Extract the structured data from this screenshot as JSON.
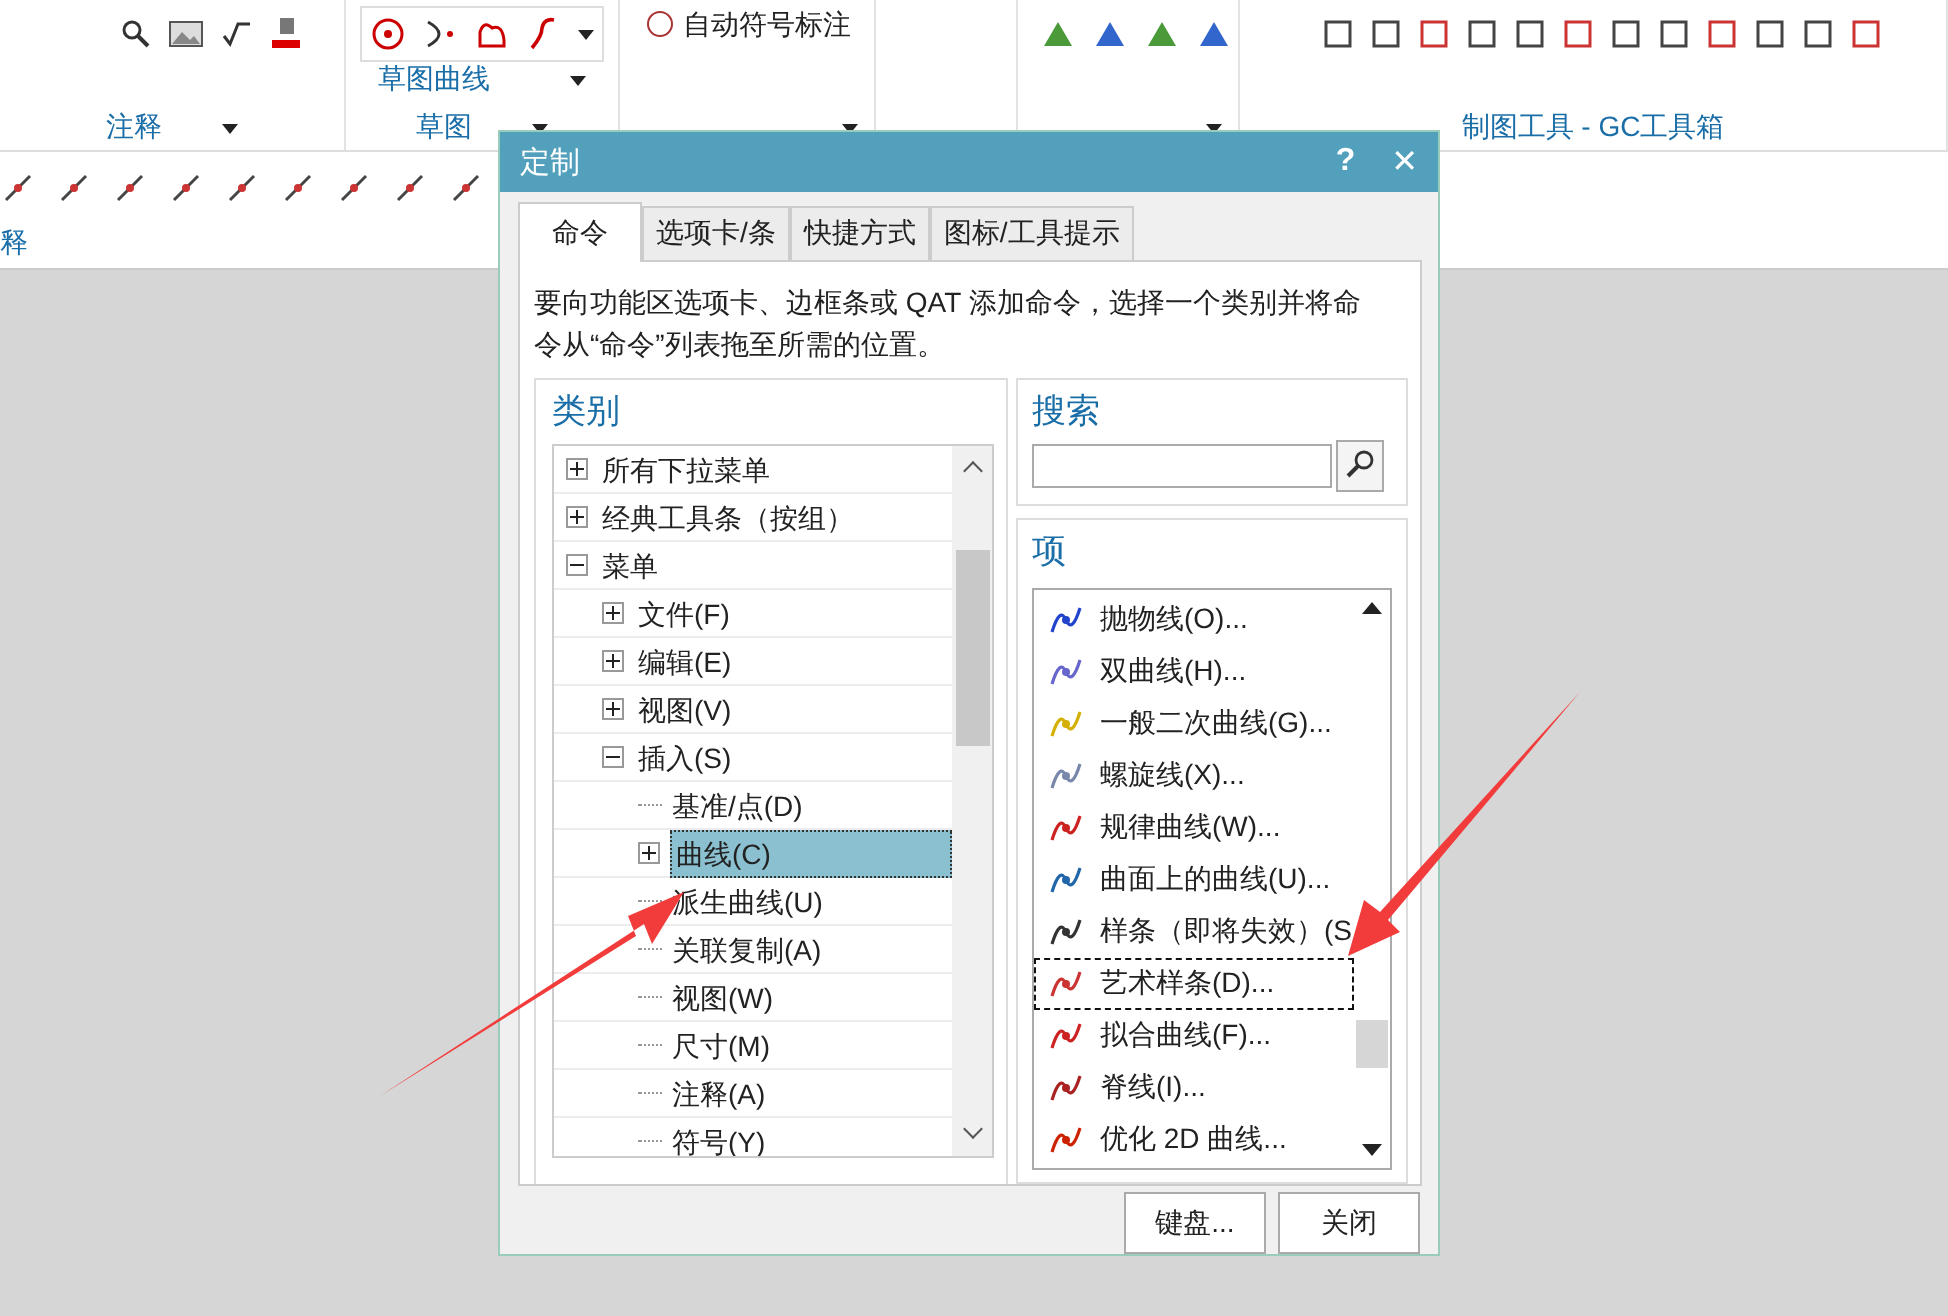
{
  "ribbon": {
    "auto_symbol_button": "自动符号标注",
    "sketch_curve_label": "草图曲线",
    "groups": [
      {
        "label": "注释"
      },
      {
        "label": "草图"
      },
      {
        "label": "制图工具 - GC工具箱"
      }
    ]
  },
  "toolbar": {
    "group_label": "释"
  },
  "dialog": {
    "title": "定制",
    "help": "?",
    "close": "✕",
    "tabs": [
      {
        "label": "命令",
        "selected": true
      },
      {
        "label": "选项卡/条",
        "selected": false
      },
      {
        "label": "快捷方式",
        "selected": false
      },
      {
        "label": "图标/工具提示",
        "selected": false
      }
    ],
    "description": "要向功能区选项卡、边框条或 QAT 添加命令，选择一个类别并将命令从“命令”列表拖至所需的位置。",
    "categories": {
      "heading": "类别",
      "items": [
        {
          "label": "所有下拉菜单",
          "expanded": false,
          "selected": false
        },
        {
          "label": "经典工具条（按组）",
          "expanded": false,
          "selected": false
        },
        {
          "label": "菜单",
          "expanded": true,
          "selected": false,
          "children": [
            {
              "label": "文件(F)",
              "expanded": false,
              "selected": false
            },
            {
              "label": "编辑(E)",
              "expanded": false,
              "selected": false
            },
            {
              "label": "视图(V)",
              "expanded": false,
              "selected": false
            },
            {
              "label": "插入(S)",
              "expanded": true,
              "selected": false,
              "children": [
                {
                  "label": "基准/点(D)",
                  "selected": false
                },
                {
                  "label": "曲线(C)",
                  "expanded": false,
                  "selected": true
                },
                {
                  "label": "派生曲线(U)",
                  "selected": false
                },
                {
                  "label": "关联复制(A)",
                  "selected": false
                },
                {
                  "label": "视图(W)",
                  "selected": false
                },
                {
                  "label": "尺寸(M)",
                  "selected": false
                },
                {
                  "label": "注释(A)",
                  "selected": false
                },
                {
                  "label": "符号(Y)",
                  "selected": false
                }
              ]
            }
          ]
        }
      ]
    },
    "search": {
      "heading": "搜索"
    },
    "items": {
      "heading": "项",
      "list": [
        {
          "label": "抛物线(O)...",
          "selected": false
        },
        {
          "label": "双曲线(H)...",
          "selected": false
        },
        {
          "label": "一般二次曲线(G)...",
          "selected": false
        },
        {
          "label": "螺旋线(X)...",
          "selected": false
        },
        {
          "label": "规律曲线(W)...",
          "selected": false
        },
        {
          "label": "曲面上的曲线(U)...",
          "selected": false
        },
        {
          "label": "样条（即将失效）(S",
          "selected": false
        },
        {
          "label": "艺术样条(D)...",
          "selected": true
        },
        {
          "label": "拟合曲线(F)...",
          "selected": false
        },
        {
          "label": "脊线(I)...",
          "selected": false
        },
        {
          "label": "优化 2D 曲线...",
          "selected": false
        }
      ]
    },
    "buttons": [
      "键盘...",
      "关闭"
    ]
  }
}
